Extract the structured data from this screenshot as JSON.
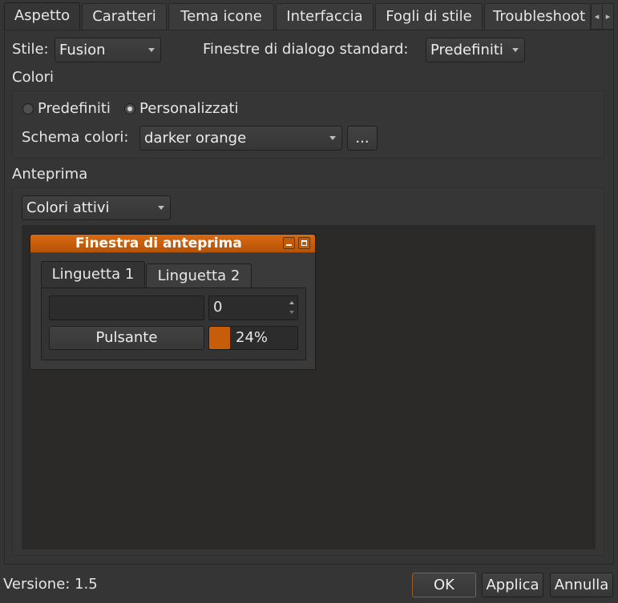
{
  "tabs": [
    {
      "label": "Aspetto",
      "active": true
    },
    {
      "label": "Caratteri"
    },
    {
      "label": "Tema icone"
    },
    {
      "label": "Interfaccia"
    },
    {
      "label": "Fogli di stile"
    },
    {
      "label": "Troubleshoot"
    }
  ],
  "style": {
    "label": "Stile:",
    "value": "Fusion",
    "dialogs_label": "Finestre di dialogo standard:",
    "dialogs_value": "Predefiniti"
  },
  "colors": {
    "section_title": "Colori",
    "radio_default": "Predefiniti",
    "radio_custom": "Personalizzati",
    "selected": "Personalizzati",
    "scheme_label": "Schema colori:",
    "scheme_value": "darker orange",
    "more_button": "..."
  },
  "preview": {
    "section_title": "Anteprima",
    "color_group_value": "Colori attivi",
    "window_title": "Finestra di anteprima",
    "tab1": "Linguetta 1",
    "tab2": "Linguetta 2",
    "spin_value": "0",
    "button_label": "Pulsante",
    "progress_text": "24%",
    "progress_value": 0.24,
    "accent_color": "#c75d0b"
  },
  "footer": {
    "version": "Versione: 1.5",
    "ok": "OK",
    "apply": "Applica",
    "cancel": "Annulla"
  }
}
